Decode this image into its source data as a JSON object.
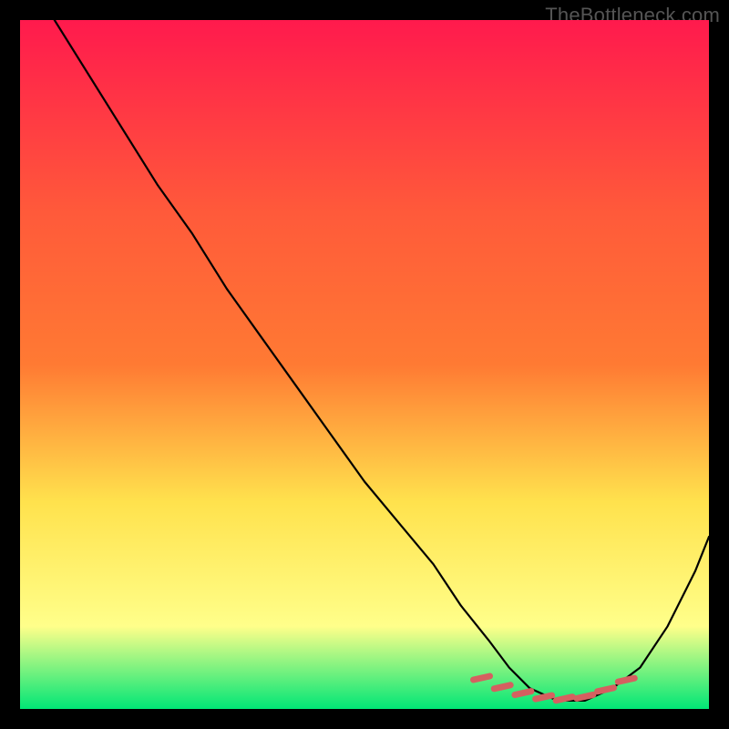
{
  "watermark": "TheBottleneck.com",
  "chart_data": {
    "type": "line",
    "title": "",
    "xlabel": "",
    "ylabel": "",
    "xlim": [
      0,
      100
    ],
    "ylim": [
      0,
      100
    ],
    "background_gradient": {
      "top": "#ff1a4d",
      "mid1": "#ff7a33",
      "mid2": "#ffe24d",
      "bottom1": "#ffff8a",
      "bottom2": "#00e676"
    },
    "series": [
      {
        "name": "bottleneck-curve",
        "x": [
          5,
          10,
          15,
          20,
          25,
          30,
          35,
          40,
          45,
          50,
          55,
          60,
          64,
          68,
          71,
          74,
          78,
          82,
          86,
          90,
          94,
          98,
          100
        ],
        "y": [
          100,
          92,
          84,
          76,
          69,
          61,
          54,
          47,
          40,
          33,
          27,
          21,
          15,
          10,
          6,
          3,
          1.2,
          1.2,
          3,
          6,
          12,
          20,
          25
        ],
        "color": "#000000"
      }
    ],
    "markers": {
      "name": "sweet-spot-markers",
      "color": "#d56060",
      "points": [
        {
          "x": 67,
          "y": 4.5
        },
        {
          "x": 70,
          "y": 3.2
        },
        {
          "x": 73,
          "y": 2.3
        },
        {
          "x": 76,
          "y": 1.7
        },
        {
          "x": 79,
          "y": 1.5
        },
        {
          "x": 82,
          "y": 1.8
        },
        {
          "x": 85,
          "y": 2.8
        },
        {
          "x": 88,
          "y": 4.2
        }
      ]
    }
  }
}
